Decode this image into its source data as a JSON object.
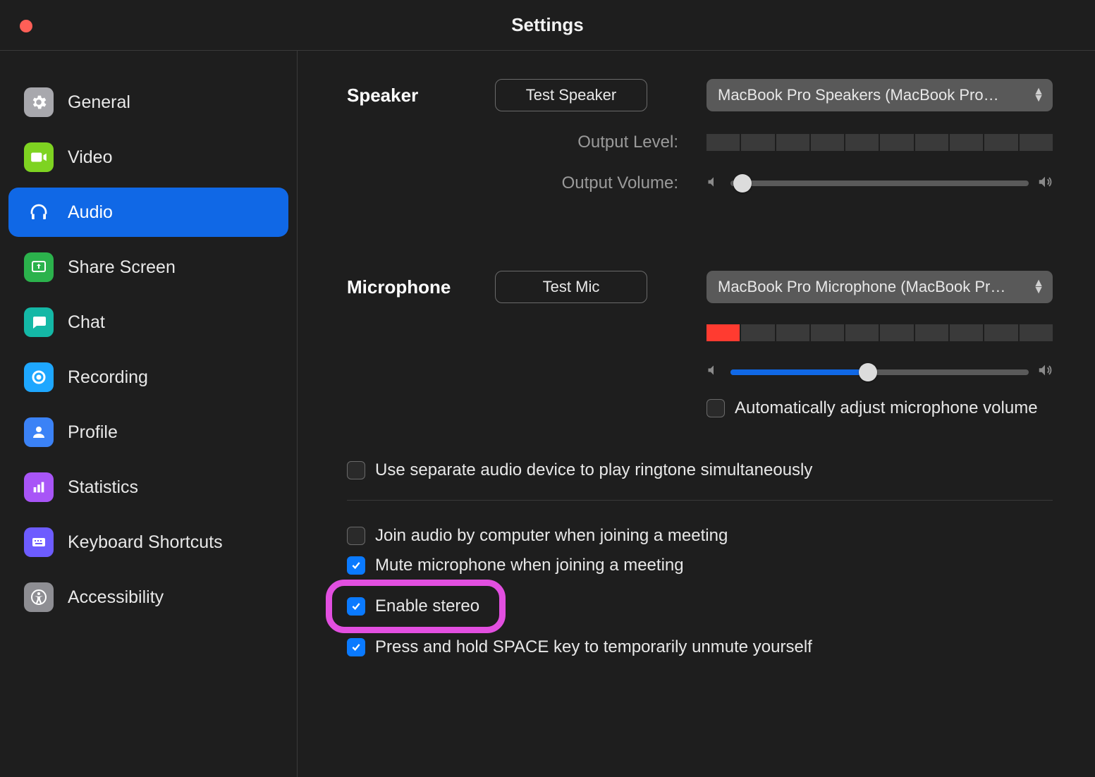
{
  "window": {
    "title": "Settings"
  },
  "sidebar": {
    "items": [
      {
        "id": "general",
        "label": "General"
      },
      {
        "id": "video",
        "label": "Video"
      },
      {
        "id": "audio",
        "label": "Audio"
      },
      {
        "id": "share",
        "label": "Share Screen"
      },
      {
        "id": "chat",
        "label": "Chat"
      },
      {
        "id": "recording",
        "label": "Recording"
      },
      {
        "id": "profile",
        "label": "Profile"
      },
      {
        "id": "stats",
        "label": "Statistics"
      },
      {
        "id": "keyboard",
        "label": "Keyboard Shortcuts"
      },
      {
        "id": "accessibility",
        "label": "Accessibility"
      }
    ],
    "selected": "audio"
  },
  "speaker": {
    "heading": "Speaker",
    "test_button": "Test Speaker",
    "device": "MacBook Pro Speakers (MacBook Pro…",
    "output_level_label": "Output Level:",
    "output_level_segments": 10,
    "output_level_value": 0,
    "output_volume_label": "Output Volume:",
    "output_volume_percent": 4
  },
  "microphone": {
    "heading": "Microphone",
    "test_button": "Test Mic",
    "device": "MacBook Pro Microphone (MacBook Pr…",
    "input_level_segments": 10,
    "input_level_value": 1,
    "input_volume_percent": 46,
    "auto_adjust": {
      "checked": false,
      "label": "Automatically adjust microphone volume"
    }
  },
  "options": {
    "ringtone": {
      "checked": false,
      "label": "Use separate audio device to play ringtone simultaneously"
    },
    "join_audio": {
      "checked": false,
      "label": "Join audio by computer when joining a meeting"
    },
    "mute_join": {
      "checked": true,
      "label": "Mute microphone when joining a meeting"
    },
    "stereo": {
      "checked": true,
      "label": "Enable stereo"
    },
    "space_unmute": {
      "checked": true,
      "label": "Press and hold SPACE key to temporarily unmute yourself"
    }
  }
}
